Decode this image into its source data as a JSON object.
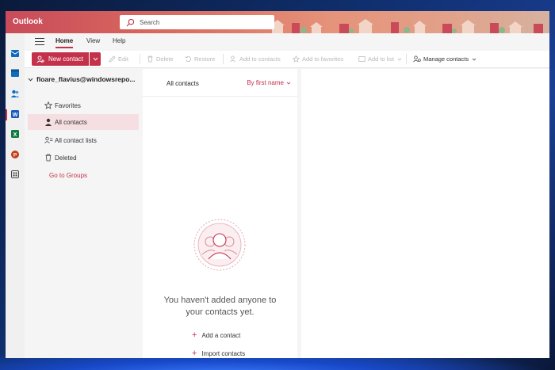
{
  "app": {
    "name": "Outlook"
  },
  "search": {
    "placeholder": "Search"
  },
  "ribbon": {
    "tabs": [
      {
        "label": "Home",
        "active": true
      },
      {
        "label": "View",
        "active": false
      },
      {
        "label": "Help",
        "active": false
      }
    ]
  },
  "toolbar": {
    "new_contact": "New contact",
    "edit": "Edit",
    "delete": "Delete",
    "restore": "Restore",
    "add_to_contacts": "Add to contacts",
    "add_to_favorites": "Add to favorites",
    "add_to_list": "Add to list",
    "manage_contacts": "Manage contacts"
  },
  "folders": {
    "account": "floare_flavius@windowsrepo...",
    "items": [
      {
        "label": "Favorites",
        "icon": "star-icon"
      },
      {
        "label": "All contacts",
        "icon": "person-icon",
        "selected": true
      },
      {
        "label": "All contact lists",
        "icon": "contact-list-icon"
      },
      {
        "label": "Deleted",
        "icon": "trash-icon"
      }
    ],
    "go_to_groups": "Go to Groups"
  },
  "list": {
    "title": "All contacts",
    "sort": "By first name",
    "empty_line1": "You haven't added anyone to",
    "empty_line2": "your contacts yet.",
    "add_contact": "Add a contact",
    "import_contacts": "Import contacts"
  },
  "colors": {
    "accent": "#c4314b",
    "selected_bg": "#f6dfe2"
  }
}
